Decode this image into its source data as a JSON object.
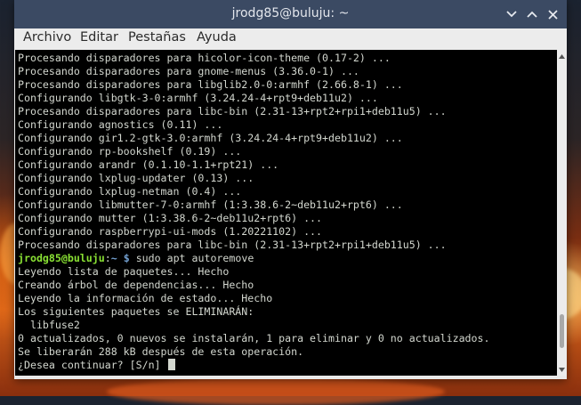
{
  "window": {
    "title": "jrodg85@buluju: ~"
  },
  "menu": {
    "items": [
      {
        "label": "Archivo"
      },
      {
        "label": "Editar"
      },
      {
        "label": "Pestañas"
      },
      {
        "label": "Ayuda"
      }
    ]
  },
  "terminal": {
    "output_before": [
      "Procesando disparadores para hicolor-icon-theme (0.17-2) ...",
      "Procesando disparadores para gnome-menus (3.36.0-1) ...",
      "Procesando disparadores para libglib2.0-0:armhf (2.66.8-1) ...",
      "Configurando libgtk-3-0:armhf (3.24.24-4+rpt9+deb11u2) ...",
      "Procesando disparadores para libc-bin (2.31-13+rpt2+rpi1+deb11u5) ...",
      "Configurando agnostics (0.11) ...",
      "Configurando gir1.2-gtk-3.0:armhf (3.24.24-4+rpt9+deb11u2) ...",
      "Configurando rp-bookshelf (0.19) ...",
      "Configurando arandr (0.1.10-1.1+rpt21) ...",
      "Configurando lxplug-updater (0.13) ...",
      "Configurando lxplug-netman (0.4) ...",
      "Configurando libmutter-7-0:armhf (1:3.38.6-2~deb11u2+rpt6) ...",
      "Configurando mutter (1:3.38.6-2~deb11u2+rpt6) ...",
      "Configurando raspberrypi-ui-mods (1.20221102) ...",
      "Procesando disparadores para libc-bin (2.31-13+rpt2+rpi1+deb11u5) ..."
    ],
    "prompt": {
      "user_host": "jrodg85@buluju",
      "path": "~",
      "symbol": "$",
      "command": "sudo apt autoremove"
    },
    "output_after": [
      "Leyendo lista de paquetes... Hecho",
      "Creando árbol de dependencias... Hecho",
      "Leyendo la información de estado... Hecho",
      "Los siguientes paquetes se ELIMINARÁN:",
      "  libfuse2",
      "0 actualizados, 0 nuevos se instalarán, 1 para eliminar y 0 no actualizados.",
      "Se liberarán 288 kB después de esta operación."
    ],
    "final_prompt": "¿Desea continuar? [S/n] "
  },
  "scrollbar": {
    "position_fraction": 0.95
  },
  "colors": {
    "titlebar": "#3b4a63",
    "terminal_bg": "#000000",
    "terminal_fg": "#d3d7cf",
    "prompt_user": "#8ae234",
    "prompt_path": "#729fcf"
  },
  "icons": {
    "minimize": "chevron-down-icon",
    "maximize": "chevron-up-icon",
    "close": "close-icon"
  }
}
